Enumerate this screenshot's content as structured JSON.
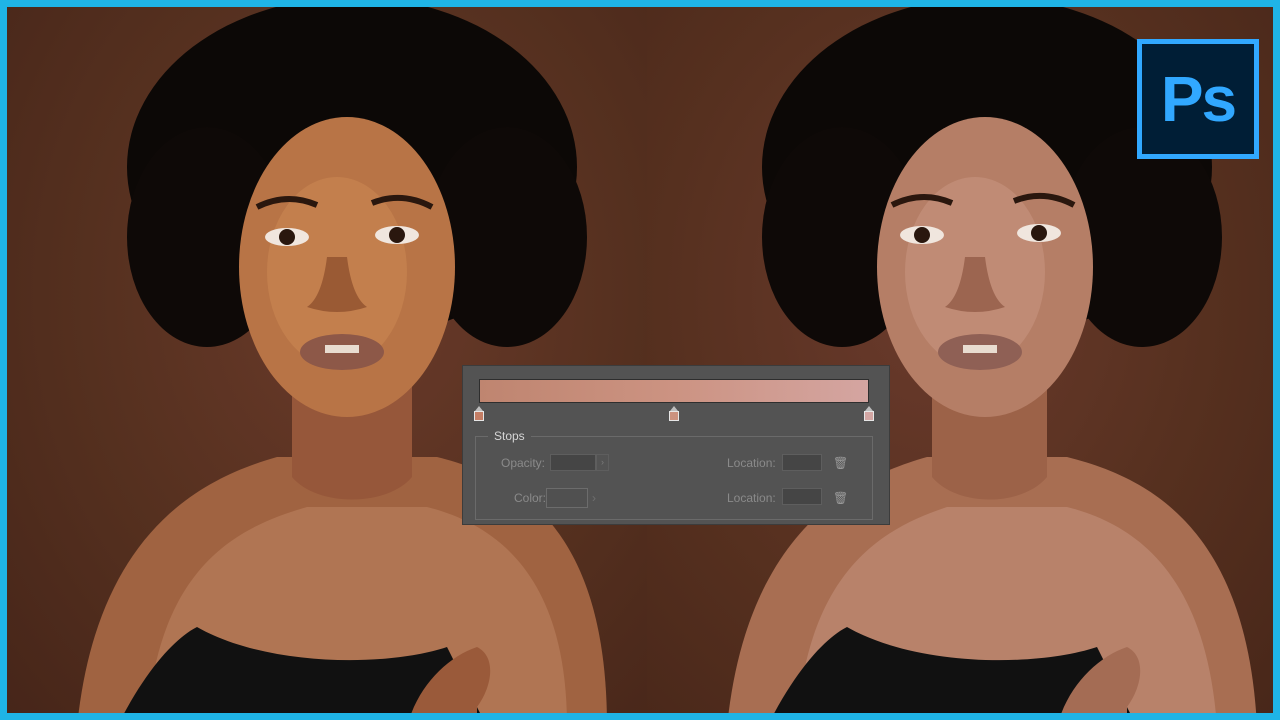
{
  "app": {
    "logo_text": "Ps"
  },
  "colors": {
    "frame_border": "#1fb4e6",
    "ps_blue": "#31a8ff",
    "ps_dark": "#001e36",
    "panel_bg": "#535353",
    "gradient_start": "#bf8570",
    "gradient_mid": "#cc9382",
    "gradient_end": "#d4a5a1"
  },
  "gradient_editor": {
    "stops": [
      {
        "location_percent": 0,
        "color": "#c47e65"
      },
      {
        "location_percent": 50,
        "color": "#cb927f"
      },
      {
        "location_percent": 100,
        "color": "#d3a6a3"
      }
    ],
    "stops_group": {
      "legend": "Stops",
      "opacity_label": "Opacity:",
      "color_label": "Color:",
      "location_label_1": "Location:",
      "location_label_2": "Location:"
    }
  },
  "icons": {
    "delete_opacity_stop": "trash-icon",
    "delete_color_stop": "trash-icon"
  }
}
